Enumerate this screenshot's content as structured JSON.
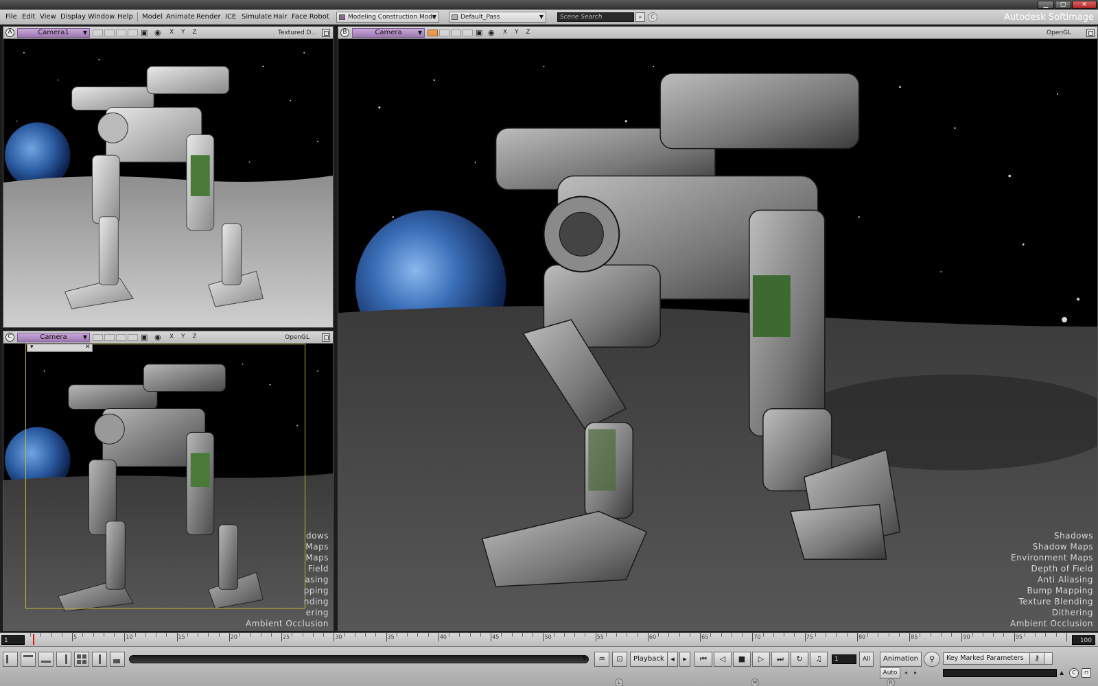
{
  "window": {
    "min_label": "▁",
    "max_label": "▢",
    "close_label": "✕"
  },
  "menu": {
    "items": [
      "File",
      "Edit",
      "View",
      "Display",
      "Window",
      "Help",
      "Model",
      "Animate",
      "Render",
      "ICE",
      "Simulate",
      "Hair",
      "Face Robot"
    ],
    "mode_dropdown": "Modeling Construction Mode",
    "pass_dropdown": "Default_Pass",
    "search_placeholder": "Scene Search",
    "brand": "Autodesk Softimage"
  },
  "viewports": {
    "a": {
      "letter": "A",
      "camera": "Camera1",
      "mode": "Textured D...",
      "overlay": "Texture Decal Mode",
      "axes": "X Y Z"
    },
    "b": {
      "letter": "B",
      "camera": "Camera",
      "mode": "OpenGL",
      "axes": "X Y Z"
    },
    "c": {
      "letter": "C",
      "camera": "Camera",
      "mode": "OpenGL",
      "axes": "X Y Z",
      "render_options_clipped": [
        "dows",
        "Maps",
        "Maps",
        "Field",
        "asing",
        "pping",
        "nding",
        "ering",
        "Ambient Occlusion"
      ]
    }
  },
  "render_options": [
    "Shadows",
    "Shadow Maps",
    "Environment Maps",
    "Depth of Field",
    "Anti Aliasing",
    "Bump Mapping",
    "Texture Blending",
    "Dithering",
    "Ambient Occlusion"
  ],
  "timeline": {
    "start": "1",
    "end": "100",
    "labels": [
      "5",
      "10",
      "15",
      "20",
      "25",
      "30",
      "35",
      "40",
      "45",
      "50",
      "55",
      "60",
      "65",
      "70",
      "75",
      "80",
      "85",
      "90",
      "95"
    ]
  },
  "playback": {
    "playback_label": "Playback",
    "current_frame": "1",
    "all_label": "All",
    "animation_label": "Animation",
    "auto_label": "Auto",
    "key_params_label": "Key Marked Parameters",
    "mouse_hints": [
      "L",
      "M",
      "R"
    ]
  },
  "colors": {
    "camera_tab": "#b28fc6",
    "frame_box": "#c8b830",
    "playhead": "#e01010"
  }
}
